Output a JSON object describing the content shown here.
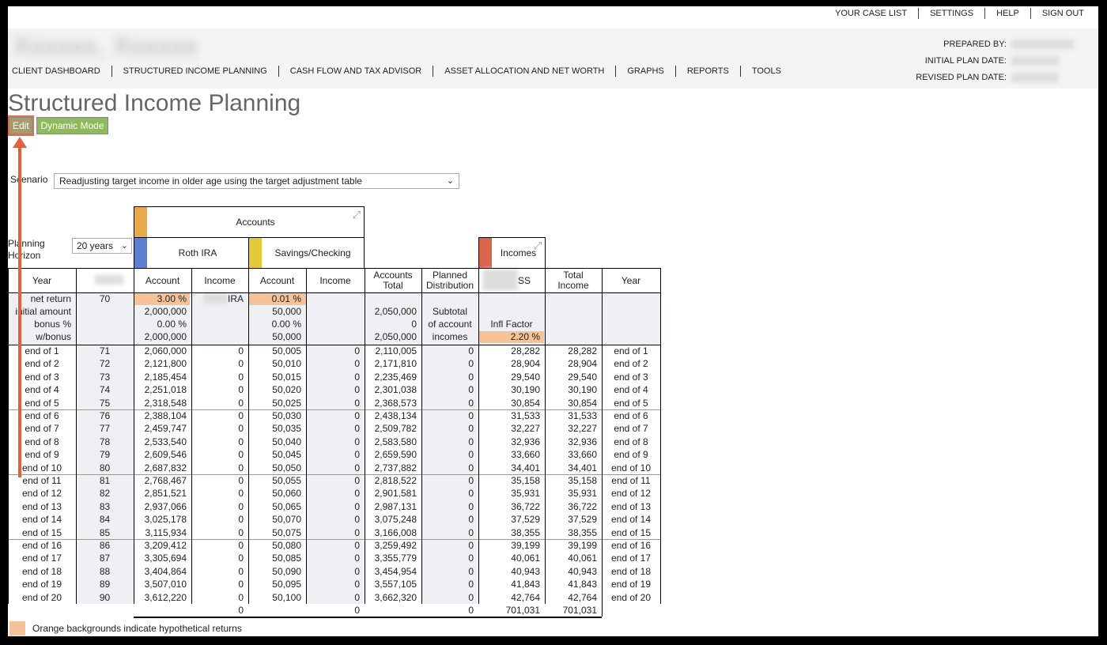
{
  "toplinks": [
    "YOUR CASE LIST",
    "SETTINGS",
    "HELP",
    "SIGN OUT"
  ],
  "prepared": {
    "by": "PREPARED BY:",
    "initial": "INITIAL PLAN DATE:",
    "revised": "REVISED PLAN DATE:"
  },
  "nav": [
    "CLIENT DASHBOARD",
    "STRUCTURED INCOME PLANNING",
    "CASH FLOW AND TAX ADVISOR",
    "ASSET ALLOCATION AND NET WORTH",
    "GRAPHS",
    "REPORTS",
    "TOOLS"
  ],
  "page_title": "Structured Income Planning",
  "buttons": {
    "edit": "Edit",
    "dynamic": "Dynamic Mode"
  },
  "scenario": {
    "label": "Scenario",
    "value": "Readjusting target income in older age using the target adjustment table"
  },
  "planning_horizon": {
    "label": "Planning Horizon",
    "value": "20 years"
  },
  "groups": {
    "accounts": "Accounts",
    "roth": "Roth IRA",
    "savings": "Savings/Checking",
    "incomes": "Incomes"
  },
  "colors": {
    "accounts": "#e8a94a",
    "roth": "#5d7fcf",
    "savings": "#e6c93a",
    "incomes": "#d9654a",
    "orange": "#f5c397"
  },
  "columns": [
    "Year",
    "",
    "Account",
    "Income",
    "Account",
    "Income",
    "Accounts Total",
    "Planned Distribution",
    "SS",
    "Total Income",
    "Year"
  ],
  "params": {
    "labels": [
      "net return",
      "initial amount",
      "bonus %",
      "w/bonus"
    ],
    "age": "70",
    "roth": [
      "3.00 %",
      "2,000,000",
      "0.00 %",
      "2,000,000"
    ],
    "roth_income_label": "IRA",
    "savings": [
      "0.01 %",
      "50,000",
      "0.00 %",
      "50,000"
    ],
    "accounts_total": [
      "",
      "2,050,000",
      "0",
      "2,050,000"
    ],
    "planned": [
      "",
      "Subtotal",
      "of account",
      "incomes"
    ],
    "ss": [
      "",
      "",
      "Infl Factor",
      "2.20 %"
    ]
  },
  "rows": [
    [
      "end of 1",
      "71",
      "2,060,000",
      "0",
      "50,005",
      "0",
      "2,110,005",
      "0",
      "28,282",
      "28,282",
      "end of 1"
    ],
    [
      "end of 2",
      "72",
      "2,121,800",
      "0",
      "50,010",
      "0",
      "2,171,810",
      "0",
      "28,904",
      "28,904",
      "end of 2"
    ],
    [
      "end of 3",
      "73",
      "2,185,454",
      "0",
      "50,015",
      "0",
      "2,235,469",
      "0",
      "29,540",
      "29,540",
      "end of 3"
    ],
    [
      "end of 4",
      "74",
      "2,251,018",
      "0",
      "50,020",
      "0",
      "2,301,038",
      "0",
      "30,190",
      "30,190",
      "end of 4"
    ],
    [
      "end of 5",
      "75",
      "2,318,548",
      "0",
      "50,025",
      "0",
      "2,368,573",
      "0",
      "30,854",
      "30,854",
      "end of 5"
    ],
    [
      "end of 6",
      "76",
      "2,388,104",
      "0",
      "50,030",
      "0",
      "2,438,134",
      "0",
      "31,533",
      "31,533",
      "end of 6"
    ],
    [
      "end of 7",
      "77",
      "2,459,747",
      "0",
      "50,035",
      "0",
      "2,509,782",
      "0",
      "32,227",
      "32,227",
      "end of 7"
    ],
    [
      "end of 8",
      "78",
      "2,533,540",
      "0",
      "50,040",
      "0",
      "2,583,580",
      "0",
      "32,936",
      "32,936",
      "end of 8"
    ],
    [
      "end of 9",
      "79",
      "2,609,546",
      "0",
      "50,045",
      "0",
      "2,659,590",
      "0",
      "33,660",
      "33,660",
      "end of 9"
    ],
    [
      "end of 10",
      "80",
      "2,687,832",
      "0",
      "50,050",
      "0",
      "2,737,882",
      "0",
      "34,401",
      "34,401",
      "end of 10"
    ],
    [
      "end of 11",
      "81",
      "2,768,467",
      "0",
      "50,055",
      "0",
      "2,818,522",
      "0",
      "35,158",
      "35,158",
      "end of 11"
    ],
    [
      "end of 12",
      "82",
      "2,851,521",
      "0",
      "50,060",
      "0",
      "2,901,581",
      "0",
      "35,931",
      "35,931",
      "end of 12"
    ],
    [
      "end of 13",
      "83",
      "2,937,066",
      "0",
      "50,065",
      "0",
      "2,987,131",
      "0",
      "36,722",
      "36,722",
      "end of 13"
    ],
    [
      "end of 14",
      "84",
      "3,025,178",
      "0",
      "50,070",
      "0",
      "3,075,248",
      "0",
      "37,529",
      "37,529",
      "end of 14"
    ],
    [
      "end of 15",
      "85",
      "3,115,934",
      "0",
      "50,075",
      "0",
      "3,166,008",
      "0",
      "38,355",
      "38,355",
      "end of 15"
    ],
    [
      "end of 16",
      "86",
      "3,209,412",
      "0",
      "50,080",
      "0",
      "3,259,492",
      "0",
      "39,199",
      "39,199",
      "end of 16"
    ],
    [
      "end of 17",
      "87",
      "3,305,694",
      "0",
      "50,085",
      "0",
      "3,355,779",
      "0",
      "40,061",
      "40,061",
      "end of 17"
    ],
    [
      "end of 18",
      "88",
      "3,404,864",
      "0",
      "50,090",
      "0",
      "3,454,954",
      "0",
      "40,943",
      "40,943",
      "end of 18"
    ],
    [
      "end of 19",
      "89",
      "3,507,010",
      "0",
      "50,095",
      "0",
      "3,557,105",
      "0",
      "41,843",
      "41,843",
      "end of 19"
    ],
    [
      "end of 20",
      "90",
      "3,612,220",
      "0",
      "50,100",
      "0",
      "3,662,320",
      "0",
      "42,764",
      "42,764",
      "end of 20"
    ]
  ],
  "totals": {
    "roth_income": "0",
    "savings_income": "0",
    "planned": "0",
    "ss": "701,031",
    "total_income": "701,031"
  },
  "legend": "Orange backgrounds indicate hypothetical returns"
}
